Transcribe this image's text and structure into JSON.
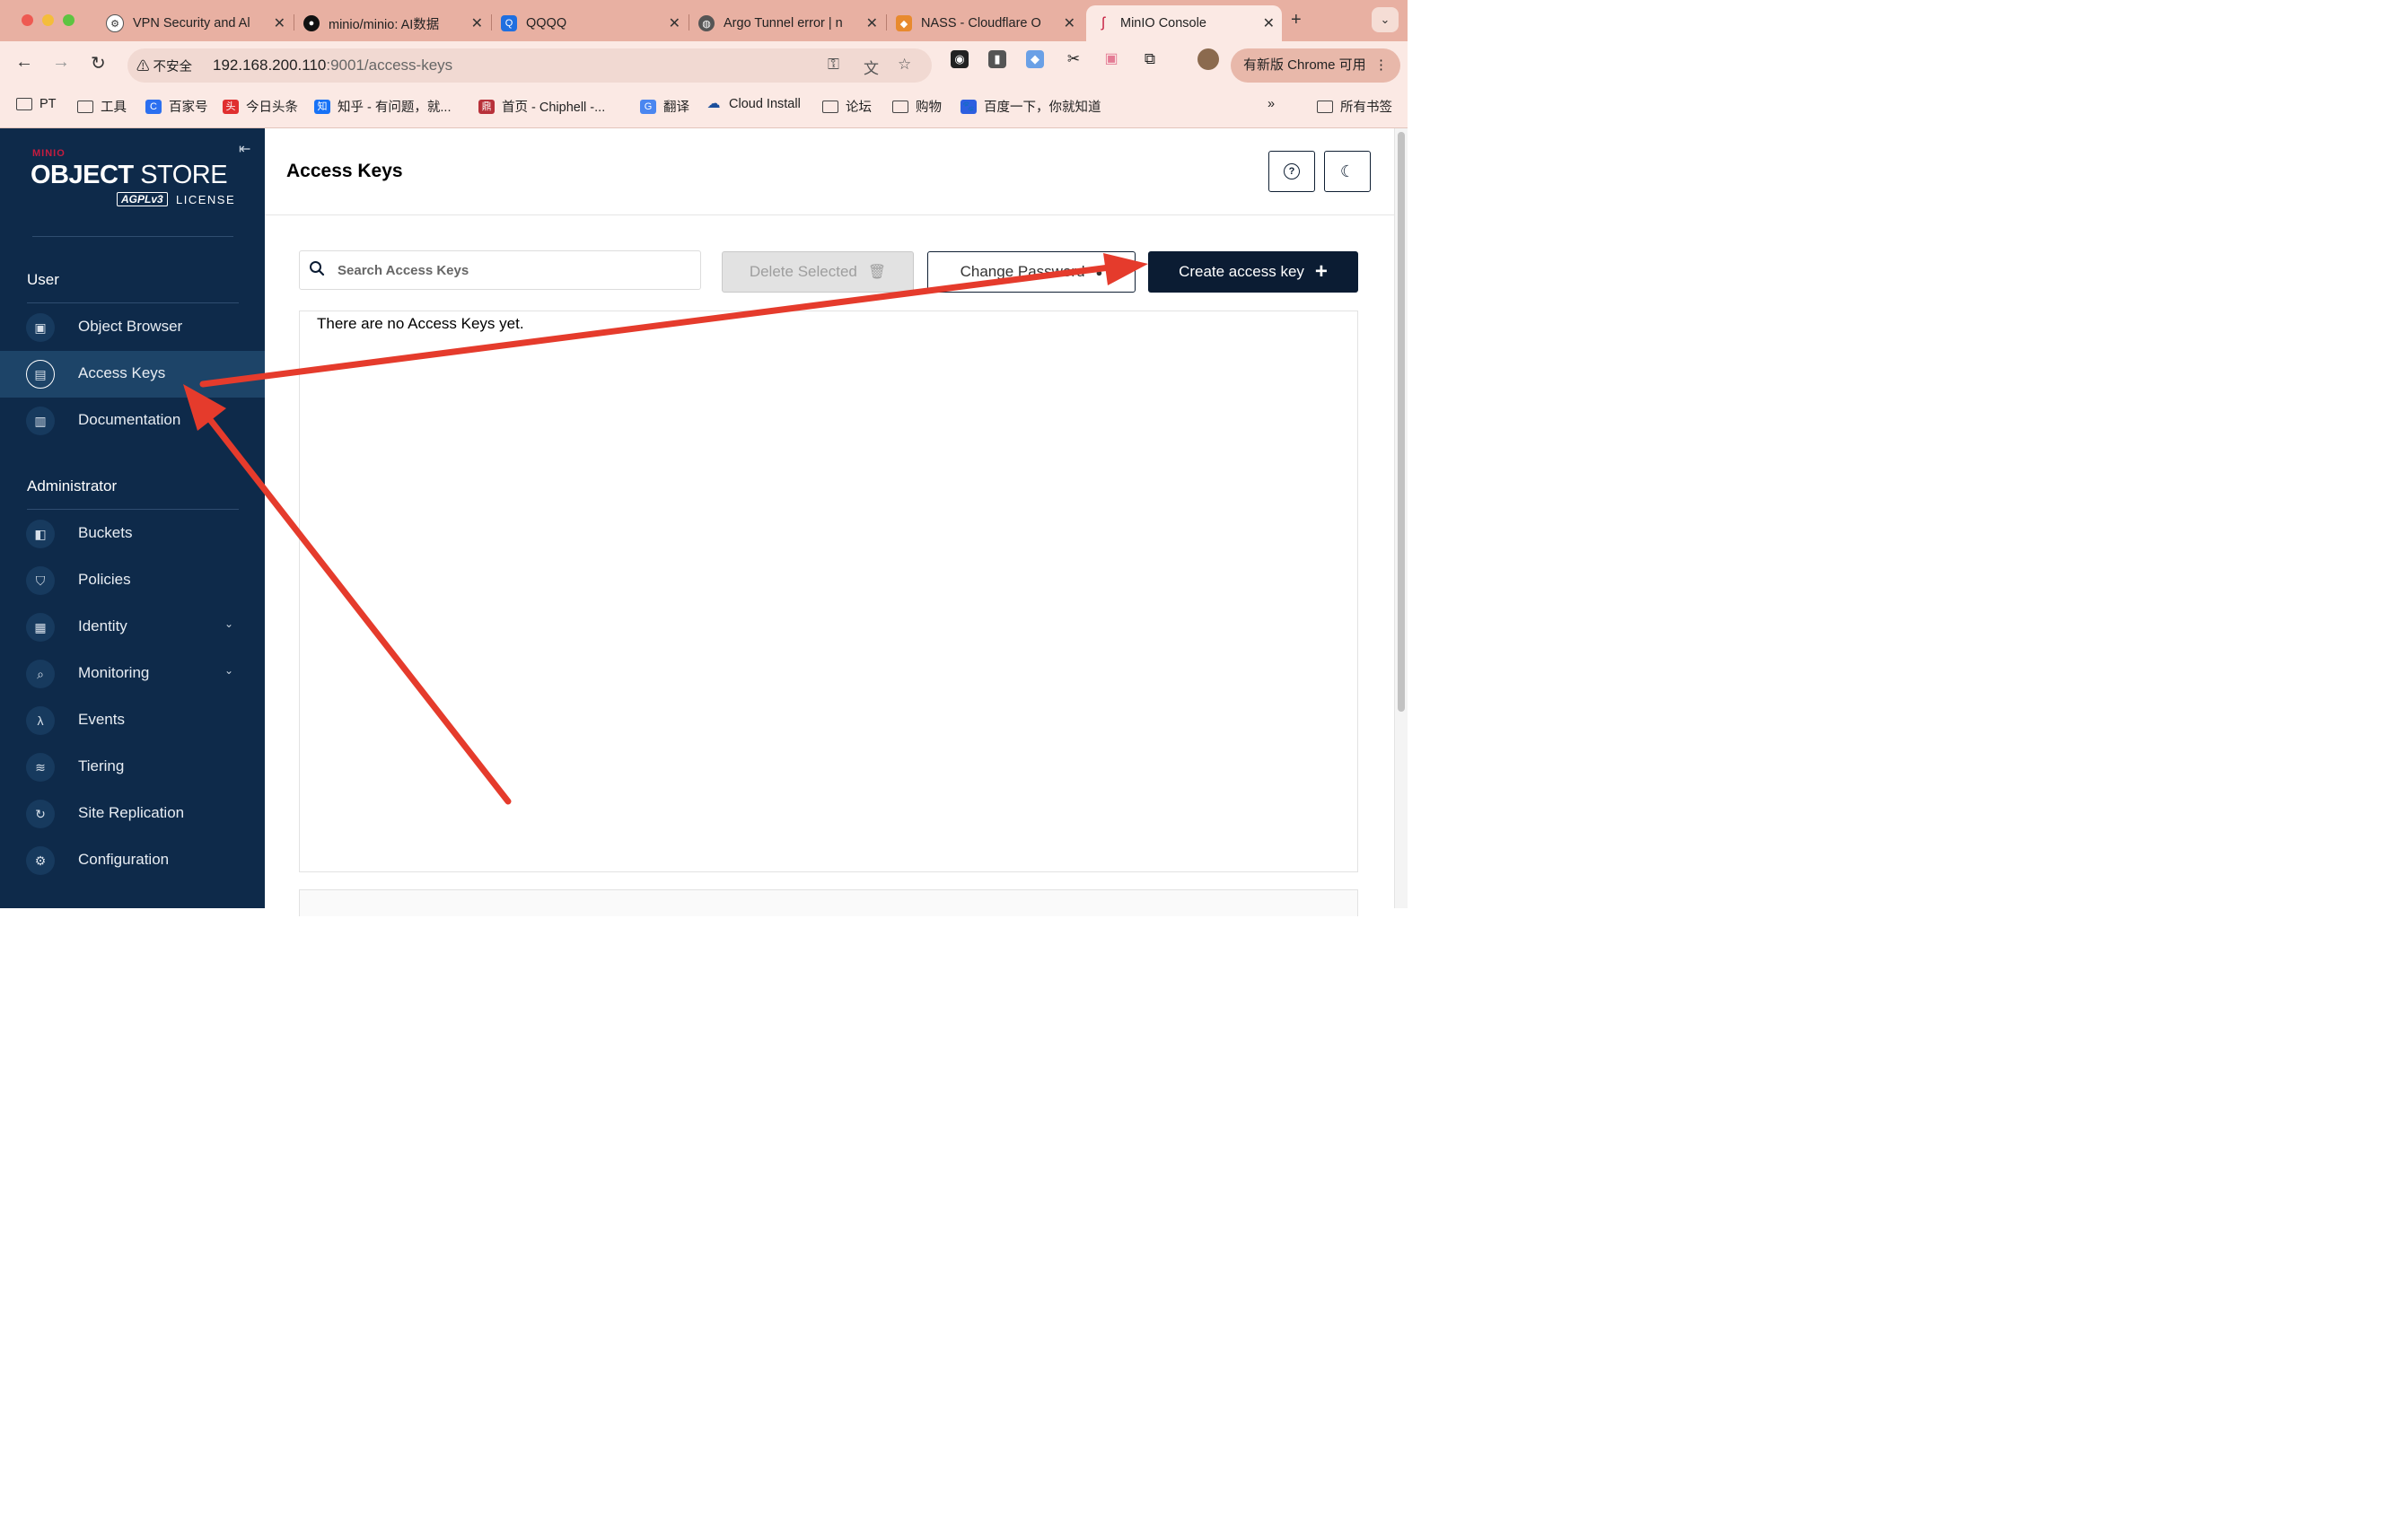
{
  "browser": {
    "tabs": [
      {
        "title": "VPN Security and Al"
      },
      {
        "title": "minio/minio: AI数据"
      },
      {
        "title": "QQQQ"
      },
      {
        "title": "Argo Tunnel error | n"
      },
      {
        "title": "NASS - Cloudflare O"
      },
      {
        "title": "MinIO Console"
      }
    ],
    "insecure_label": "不安全",
    "url_host": "192.168.200.110",
    "url_path": ":9001/access-keys",
    "update_label": "有新版 Chrome 可用",
    "bookmarks": [
      "PT",
      "工具",
      "百家号",
      "今日头条",
      "知乎 - 有问题，就...",
      "首页 - Chiphell -...",
      "翻译",
      "Cloud Install",
      "论坛",
      "购物",
      "百度一下，你就知道"
    ],
    "all_bookmarks": "所有书签"
  },
  "sidebar": {
    "logo_minio": "MINIO",
    "logo_object": "OBJECT",
    "logo_store": "STORE",
    "logo_agpl": "AGPLv3",
    "logo_license": "LICENSE",
    "user_section": "User",
    "user_items": [
      {
        "label": "Object Browser",
        "icon": "object-browser-icon"
      },
      {
        "label": "Access Keys",
        "icon": "access-keys-icon",
        "active": true
      },
      {
        "label": "Documentation",
        "icon": "documentation-icon"
      }
    ],
    "admin_section": "Administrator",
    "admin_items": [
      {
        "label": "Buckets",
        "icon": "buckets-icon"
      },
      {
        "label": "Policies",
        "icon": "policies-icon"
      },
      {
        "label": "Identity",
        "icon": "identity-icon",
        "expandable": true
      },
      {
        "label": "Monitoring",
        "icon": "monitoring-icon",
        "expandable": true
      },
      {
        "label": "Events",
        "icon": "lambda-icon"
      },
      {
        "label": "Tiering",
        "icon": "tiering-icon"
      },
      {
        "label": "Site Replication",
        "icon": "site-replication-icon"
      },
      {
        "label": "Configuration",
        "icon": "gear-icon"
      }
    ]
  },
  "main": {
    "title": "Access Keys",
    "search_placeholder": "Search Access Keys",
    "delete_label": "Delete Selected",
    "change_password_label": "Change Password",
    "create_label": "Create access key",
    "empty_message": "There are no Access Keys yet."
  },
  "colors": {
    "sidebar_bg": "#0e2a4a",
    "primary_button": "#0b1c33",
    "annotation_arrow": "#e53b2c",
    "tabbar": "#e8b0a2"
  }
}
